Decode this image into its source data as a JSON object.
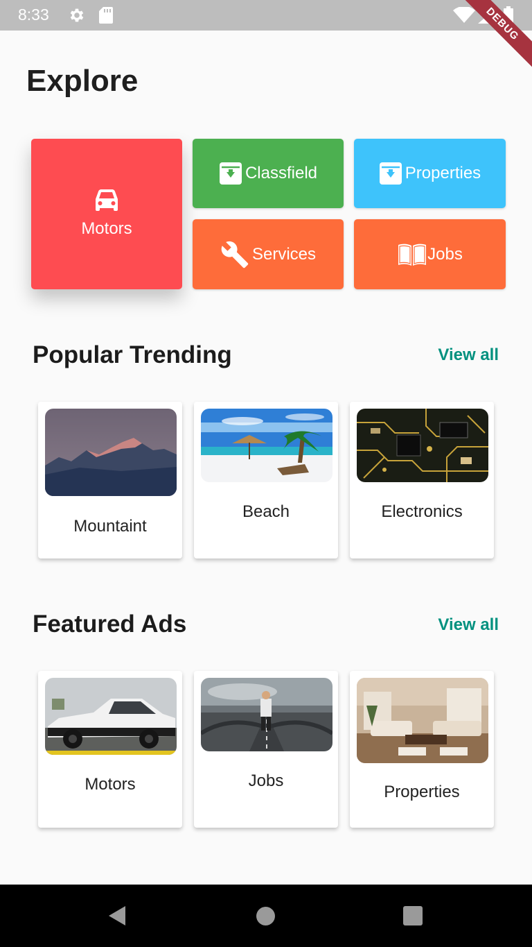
{
  "status_bar": {
    "time": "8:33",
    "icons": [
      "gear-icon",
      "sd-card-icon",
      "wifi-icon",
      "signal-icon",
      "battery-icon"
    ]
  },
  "debug_banner": "DEBUG",
  "page_title": "Explore",
  "categories": {
    "motors": {
      "label": "Motors",
      "icon": "car-icon",
      "color": "#fe4c51"
    },
    "classfield": {
      "label": "Classfield",
      "icon": "archive-icon",
      "color": "#4cb050"
    },
    "properties": {
      "label": "Properties",
      "icon": "archive-icon",
      "color": "#3ec3fb"
    },
    "services": {
      "label": "Services",
      "icon": "wrench-icon",
      "color": "#fe6c3a"
    },
    "jobs": {
      "label": "Jobs",
      "icon": "book-icon",
      "color": "#fe6c3a"
    }
  },
  "popular": {
    "title": "Popular Trending",
    "view_all": "View all",
    "items": [
      {
        "label": "Mountaint",
        "image": "mountain-image"
      },
      {
        "label": "Beach",
        "image": "beach-image"
      },
      {
        "label": "Electronics",
        "image": "circuit-board-image"
      }
    ]
  },
  "featured": {
    "title": "Featured Ads",
    "view_all": "View all",
    "items": [
      {
        "label": "Motors",
        "image": "car-image"
      },
      {
        "label": "Jobs",
        "image": "road-man-image"
      },
      {
        "label": "Properties",
        "image": "living-room-image"
      }
    ]
  },
  "colors": {
    "accent": "#03917f",
    "background": "#fafafa"
  }
}
